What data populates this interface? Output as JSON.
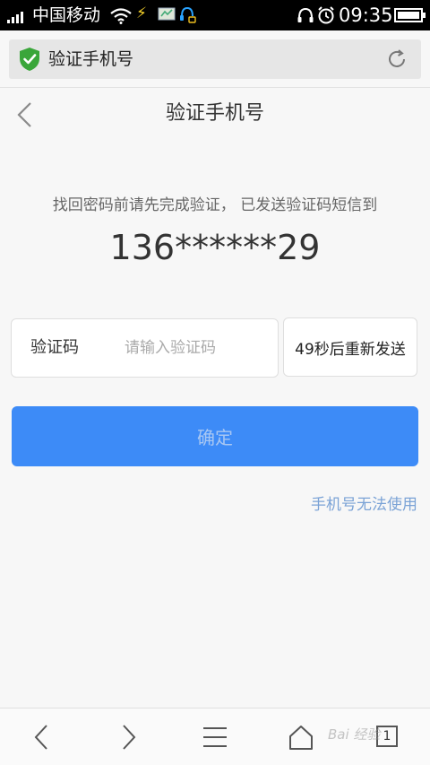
{
  "status_bar": {
    "carrier": "中国移动",
    "time": "09:35"
  },
  "browser": {
    "url_title": "验证手机号",
    "shield_color": "#3aa63a"
  },
  "page": {
    "title": "验证手机号",
    "hint": "找回密码前请先完成验证，  已发送验证码短信到",
    "phone_masked": "136******29",
    "code_label": "验证码",
    "code_placeholder": "请输入验证码",
    "code_value": "",
    "resend_label": "49秒后重新发送",
    "confirm_label": "确定",
    "phone_unusable_link": "手机号无法使用",
    "accent_color": "#3d8bf7"
  },
  "toolbar": {
    "tab_count": "1"
  },
  "watermark": {
    "text": "Bai 经验"
  }
}
